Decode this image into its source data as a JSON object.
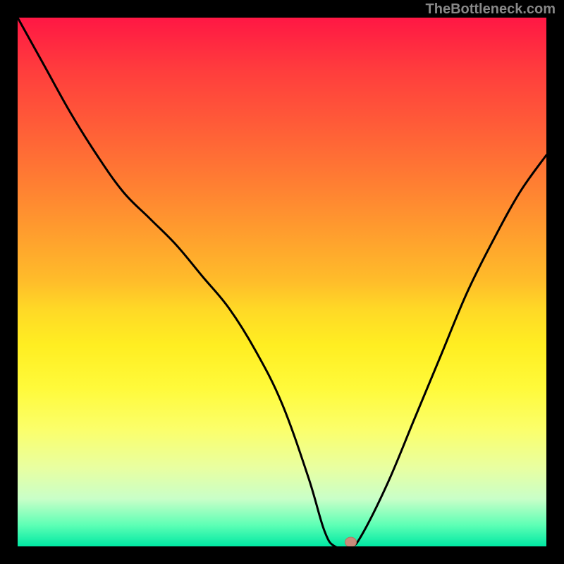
{
  "watermark": "TheBottleneck.com",
  "chart_data": {
    "type": "line",
    "title": "",
    "xlabel": "",
    "ylabel": "",
    "xlim": [
      0,
      100
    ],
    "ylim": [
      0,
      100
    ],
    "grid": false,
    "legend": false,
    "annotations": [],
    "series": [
      {
        "name": "curve",
        "x": [
          0,
          5,
          10,
          15,
          20,
          25,
          30,
          35,
          40,
          45,
          50,
          55,
          58,
          60,
          63,
          65,
          70,
          75,
          80,
          85,
          90,
          95,
          100
        ],
        "values": [
          100,
          91,
          82,
          74,
          67,
          62,
          57,
          51,
          45,
          37,
          27,
          13,
          3,
          0,
          0,
          2,
          12,
          24,
          36,
          48,
          58,
          67,
          74
        ]
      }
    ],
    "marker": {
      "x": 63,
      "y": 0.8
    },
    "background_gradient": {
      "top": "#ff1744",
      "mid1": "#ffbd2a",
      "mid2": "#ffee22",
      "bottom": "#00e8a3"
    }
  }
}
